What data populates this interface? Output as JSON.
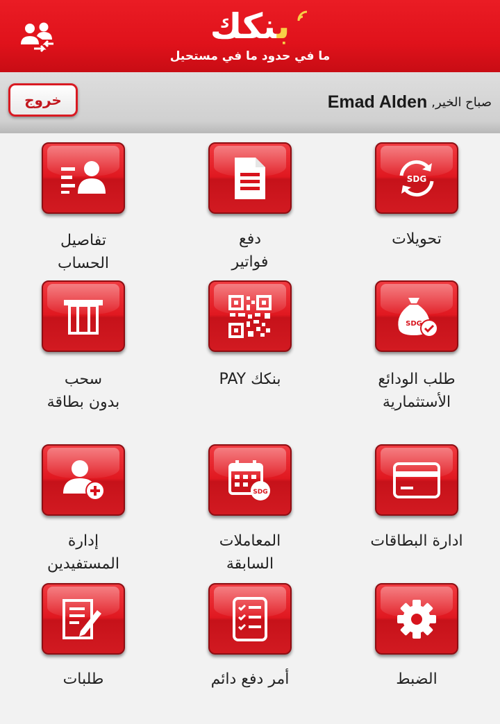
{
  "header": {
    "logo_ba": "ب",
    "logo_rest": "نكك",
    "tagline": "ما في حدود ما في مستحيل",
    "users_icon": "users-switch-icon"
  },
  "greeting": {
    "word": "صباح الخير,",
    "name": "Emad Alden",
    "logout": "خروج"
  },
  "tiles": {
    "transfers": {
      "line1": "تحويلات",
      "line2": "",
      "icon": "sdg-transfer-icon"
    },
    "bills": {
      "line1": "دفع",
      "line2": "فواتير",
      "icon": "document-icon"
    },
    "account": {
      "line1": "تفاصيل",
      "line2": "الحساب",
      "icon": "account-details-icon"
    },
    "deposits": {
      "line1": "طلب الودائع",
      "line2": "الأستثمارية",
      "icon": "money-bag-sdg-icon"
    },
    "pay": {
      "line1": "بنكك PAY",
      "line2": "",
      "icon": "qr-code-icon"
    },
    "cardless": {
      "line1": "سحب",
      "line2": "بدون بطاقة",
      "icon": "atm-icon"
    },
    "cards": {
      "line1": "ادارة البطاقات",
      "line2": "",
      "icon": "credit-card-icon"
    },
    "history": {
      "line1": "المعاملات",
      "line2": "السابقة",
      "icon": "calendar-sdg-icon"
    },
    "beneficiaries": {
      "line1": "إدارة",
      "line2": "المستفيدين",
      "icon": "add-user-icon"
    },
    "settings": {
      "line1": "الضبط",
      "line2": "",
      "icon": "gear-icon"
    },
    "standing_order": {
      "line1": "أمر دفع دائم",
      "line2": "",
      "icon": "checklist-icon"
    },
    "requests": {
      "line1": "طلبات",
      "line2": "",
      "icon": "form-pen-icon"
    }
  }
}
